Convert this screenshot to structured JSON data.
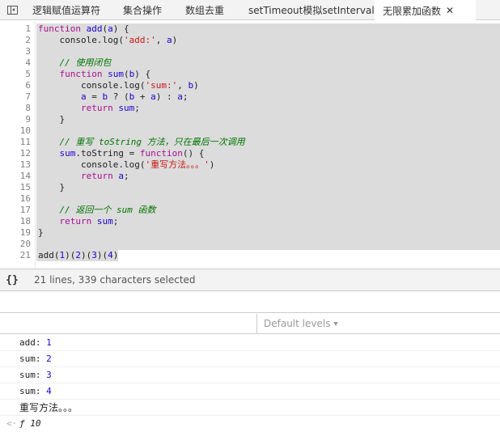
{
  "tabs": [
    {
      "label": "逻辑赋值运算符"
    },
    {
      "label": "集合操作"
    },
    {
      "label": "数组去重"
    },
    {
      "label": "setTimeout模拟setInterval"
    },
    {
      "label": "无限累加函数",
      "active": true
    }
  ],
  "tab_close_glyph": "✕",
  "editor": {
    "line_numbers": [
      "1",
      "2",
      "3",
      "4",
      "5",
      "6",
      "7",
      "8",
      "9",
      "10",
      "11",
      "12",
      "13",
      "14",
      "15",
      "16",
      "17",
      "18",
      "19",
      "20",
      "21"
    ],
    "lines": [
      [
        {
          "t": "function",
          "c": "kw"
        },
        {
          "t": " ",
          "c": "pl"
        },
        {
          "t": "add",
          "c": "fn"
        },
        {
          "t": "(",
          "c": "pl"
        },
        {
          "t": "a",
          "c": "fn"
        },
        {
          "t": ") {",
          "c": "pl"
        }
      ],
      [
        {
          "t": "    console.log(",
          "c": "pl"
        },
        {
          "t": "'add:'",
          "c": "str"
        },
        {
          "t": ", ",
          "c": "pl"
        },
        {
          "t": "a",
          "c": "fn"
        },
        {
          "t": ")",
          "c": "pl"
        }
      ],
      [],
      [
        {
          "t": "    ",
          "c": "pl"
        },
        {
          "t": "// 使用闭包",
          "c": "cm"
        }
      ],
      [
        {
          "t": "    ",
          "c": "pl"
        },
        {
          "t": "function",
          "c": "kw"
        },
        {
          "t": " ",
          "c": "pl"
        },
        {
          "t": "sum",
          "c": "fn"
        },
        {
          "t": "(",
          "c": "pl"
        },
        {
          "t": "b",
          "c": "fn"
        },
        {
          "t": ") {",
          "c": "pl"
        }
      ],
      [
        {
          "t": "        console.log(",
          "c": "pl"
        },
        {
          "t": "'sum:'",
          "c": "str"
        },
        {
          "t": ", ",
          "c": "pl"
        },
        {
          "t": "b",
          "c": "fn"
        },
        {
          "t": ")",
          "c": "pl"
        }
      ],
      [
        {
          "t": "        ",
          "c": "pl"
        },
        {
          "t": "a",
          "c": "fn"
        },
        {
          "t": " = ",
          "c": "pl"
        },
        {
          "t": "b",
          "c": "fn"
        },
        {
          "t": " ? (",
          "c": "pl"
        },
        {
          "t": "b",
          "c": "fn"
        },
        {
          "t": " + ",
          "c": "pl"
        },
        {
          "t": "a",
          "c": "fn"
        },
        {
          "t": ") : ",
          "c": "pl"
        },
        {
          "t": "a",
          "c": "fn"
        },
        {
          "t": ";",
          "c": "pl"
        }
      ],
      [
        {
          "t": "        ",
          "c": "pl"
        },
        {
          "t": "return",
          "c": "kw"
        },
        {
          "t": " ",
          "c": "pl"
        },
        {
          "t": "sum",
          "c": "fn"
        },
        {
          "t": ";",
          "c": "pl"
        }
      ],
      [
        {
          "t": "    }",
          "c": "pl"
        }
      ],
      [],
      [
        {
          "t": "    ",
          "c": "pl"
        },
        {
          "t": "// 重写 toString 方法，只在最后一次调用",
          "c": "cm"
        }
      ],
      [
        {
          "t": "    ",
          "c": "pl"
        },
        {
          "t": "sum",
          "c": "fn"
        },
        {
          "t": ".toString = ",
          "c": "pl"
        },
        {
          "t": "function",
          "c": "kw"
        },
        {
          "t": "() {",
          "c": "pl"
        }
      ],
      [
        {
          "t": "        console.log(",
          "c": "pl"
        },
        {
          "t": "'重写方法。。。'",
          "c": "str"
        },
        {
          "t": ")",
          "c": "pl"
        }
      ],
      [
        {
          "t": "        ",
          "c": "pl"
        },
        {
          "t": "return",
          "c": "kw"
        },
        {
          "t": " ",
          "c": "pl"
        },
        {
          "t": "a",
          "c": "fn"
        },
        {
          "t": ";",
          "c": "pl"
        }
      ],
      [
        {
          "t": "    }",
          "c": "pl"
        }
      ],
      [],
      [
        {
          "t": "    ",
          "c": "pl"
        },
        {
          "t": "// 返回一个 sum 函数",
          "c": "cm"
        }
      ],
      [
        {
          "t": "    ",
          "c": "pl"
        },
        {
          "t": "return",
          "c": "kw"
        },
        {
          "t": " ",
          "c": "pl"
        },
        {
          "t": "sum",
          "c": "fn"
        },
        {
          "t": ";",
          "c": "pl"
        }
      ],
      [
        {
          "t": "}",
          "c": "pl"
        }
      ],
      [],
      [
        {
          "t": "add(",
          "c": "pl"
        },
        {
          "t": "1",
          "c": "fn"
        },
        {
          "t": ")(",
          "c": "pl"
        },
        {
          "t": "2",
          "c": "fn"
        },
        {
          "t": ")(",
          "c": "pl"
        },
        {
          "t": "3",
          "c": "fn"
        },
        {
          "t": ")(",
          "c": "pl"
        },
        {
          "t": "4",
          "c": "fn"
        },
        {
          "t": ")",
          "c": "pl"
        }
      ]
    ]
  },
  "status": {
    "icon_text": "{}",
    "text": "21 lines, 339 characters selected"
  },
  "console": {
    "levels_label": "Default levels",
    "messages": [
      {
        "label": "add: ",
        "value": "1"
      },
      {
        "label": "sum: ",
        "value": "2"
      },
      {
        "label": "sum: ",
        "value": "3"
      },
      {
        "label": "sum: ",
        "value": "4"
      },
      {
        "label": "重写方法。。。",
        "value": ""
      }
    ],
    "result": {
      "arrow": "<·",
      "fn_symbol": "ƒ",
      "value": " 10"
    }
  }
}
